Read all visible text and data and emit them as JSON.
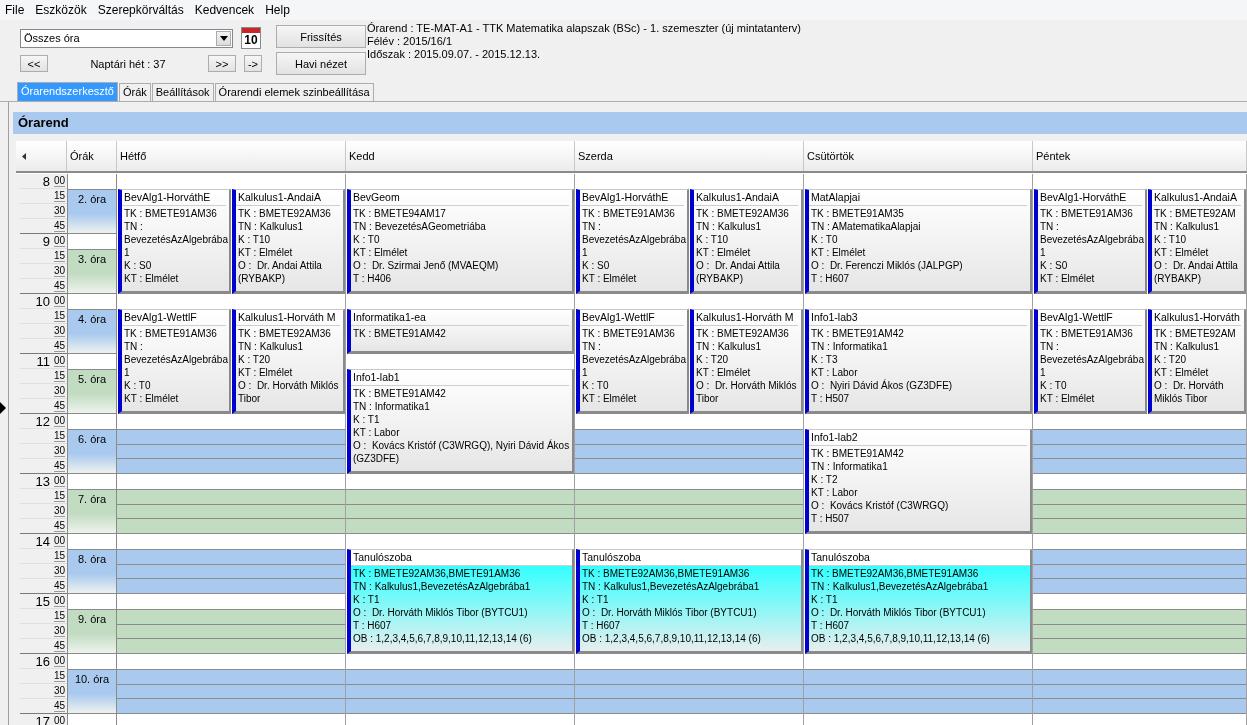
{
  "menu": [
    "File",
    "Eszközök",
    "Szerepkörváltás",
    "Kedvencek",
    "Help"
  ],
  "toolbar": {
    "view_select": {
      "value": "Összes óra"
    },
    "calendar_day": "10",
    "prev_button": "<<",
    "week_label": "Naptári hét : 37",
    "next_button": ">>",
    "jump_button": "->",
    "refresh_button": "Frissítés",
    "month_view_button": "Havi nézet"
  },
  "info": [
    "Órarend : TE-MAT-A1 - TTK Matematika alapszak (BSc) - 1. szemeszter (új mintatanterv)",
    "Félév : 2015/16/1",
    "Időszak : 2015.09.07. - 2015.12.13."
  ],
  "tabs": [
    {
      "label": "Órarendszerkesztő",
      "selected": true
    },
    {
      "label": "Órák",
      "selected": false
    },
    {
      "label": "Beállítások",
      "selected": false
    },
    {
      "label": "Órarendi elemek szinbeállítása",
      "selected": false
    }
  ],
  "panel_title": "Órarend",
  "periods_heading": "Órák",
  "hours": [
    {
      "hour": "8",
      "minutes": [
        "00",
        "15",
        "30",
        "45"
      ]
    },
    {
      "hour": "9",
      "minutes": [
        "00",
        "15",
        "30",
        "45"
      ]
    },
    {
      "hour": "10",
      "minutes": [
        "00",
        "15",
        "30",
        "45"
      ]
    },
    {
      "hour": "11",
      "minutes": [
        "00",
        "15",
        "30",
        "45"
      ]
    },
    {
      "hour": "12",
      "minutes": [
        "00",
        "15",
        "30",
        "45"
      ]
    },
    {
      "hour": "13",
      "minutes": [
        "00",
        "15",
        "30",
        "45"
      ]
    },
    {
      "hour": "14",
      "minutes": [
        "00",
        "15",
        "30",
        "45"
      ]
    },
    {
      "hour": "15",
      "minutes": [
        "00",
        "15",
        "30",
        "45"
      ]
    },
    {
      "hour": "16",
      "minutes": [
        "00",
        "15",
        "30",
        "45"
      ]
    },
    {
      "hour": "17",
      "minutes": [
        "00"
      ]
    }
  ],
  "periods": [
    {
      "label": "2. óra",
      "color": "#a9c9ef"
    },
    {
      "label": "3. óra",
      "color": "#c2dcc2"
    },
    {
      "label": "4. óra",
      "color": "#a9c9ef"
    },
    {
      "label": "5. óra",
      "color": "#c2dcc2"
    },
    {
      "label": "6. óra",
      "color": "#a9c9ef"
    },
    {
      "label": "7. óra",
      "color": "#c2dcc2"
    },
    {
      "label": "8. óra",
      "color": "#a9c9ef"
    },
    {
      "label": "9. óra",
      "color": "#c2dcc2"
    },
    {
      "label": "10. óra",
      "color": "#a9c9ef"
    }
  ],
  "days": [
    {
      "name": "Hétfő",
      "blocks": [
        {
          "kind": "double",
          "events": [
            {
              "title": "BevAlg1-HorváthE",
              "highlighted": false,
              "details": [
                "TK : BMETE91AM36",
                "TN : BevezetésAzAlgebrába1",
                "K : S0",
                "KT : Elmélet"
              ]
            },
            {
              "title": "Kalkulus1-AndaiA",
              "highlighted": false,
              "details": [
                "TK : BMETE92AM36",
                "TN : Kalkulus1",
                "K : T10",
                "KT : Elmélet",
                "O :  Dr. Andai Attila (RYBAKP)"
              ]
            }
          ]
        },
        {
          "kind": "double",
          "events": [
            {
              "title": "BevAlg1-WettlF",
              "highlighted": false,
              "details": [
                "TK : BMETE91AM36",
                "TN : BevezetésAzAlgebrába1",
                "K : T0",
                "KT : Elmélet"
              ]
            },
            {
              "title": "Kalkulus1-Horváth M",
              "highlighted": false,
              "details": [
                "TK : BMETE92AM36",
                "TN : Kalkulus1",
                "K : T20",
                "KT : Elmélet",
                "O :  Dr. Horváth Miklós Tibor"
              ]
            }
          ]
        },
        {
          "kind": "free"
        },
        {
          "kind": "free"
        },
        {
          "kind": "free"
        },
        {
          "kind": "free"
        },
        {
          "kind": "free"
        }
      ]
    },
    {
      "name": "Kedd",
      "blocks": [
        {
          "kind": "double",
          "events": [
            {
              "title": "BevGeom",
              "highlighted": false,
              "details": [
                "TK : BMETE94AM17",
                "TN : BevezetésAGeometriába",
                "K : T0",
                "KT : Elmélet",
                "O :  Dr. Szirmai Jenő (MVAEQM)",
                "T : H406"
              ]
            }
          ]
        },
        {
          "kind": "single",
          "events": [
            {
              "title": "Informatika1-ea",
              "highlighted": false,
              "details": [
                "TK : BMETE91AM42"
              ]
            }
          ]
        },
        {
          "kind": "double",
          "events": [
            {
              "title": "Info1-lab1",
              "highlighted": false,
              "details": [
                "TK : BMETE91AM42",
                "TN : Informatika1",
                "K : T1",
                "KT : Labor",
                "O :  Kovács Kristóf (C3WRGQ), Nyiri Dávid Ákos (GZ3DFE)"
              ]
            }
          ]
        },
        {
          "kind": "free"
        },
        {
          "kind": "double",
          "events": [
            {
              "title": "Tanulószoba",
              "highlighted": true,
              "details": [
                "TK : BMETE92AM36,BMETE91AM36",
                "TN : Kalkulus1,BevezetésAzAlgebrába1",
                "K : T1",
                "O :  Dr. Horváth Miklós Tibor (BYTCU1)",
                "T : H607",
                "OB : 1,2,3,4,5,6,7,8,9,10,11,12,13,14 (6)"
              ]
            }
          ]
        },
        {
          "kind": "free"
        }
      ]
    },
    {
      "name": "Szerda",
      "blocks": [
        {
          "kind": "double",
          "events": [
            {
              "title": "BevAlg1-HorváthE",
              "highlighted": false,
              "details": [
                "TK : BMETE91AM36",
                "TN : BevezetésAzAlgebrába1",
                "K : S0",
                "KT : Elmélet"
              ]
            },
            {
              "title": "Kalkulus1-AndaiA",
              "highlighted": false,
              "details": [
                "TK : BMETE92AM36",
                "TN : Kalkulus1",
                "K : T10",
                "KT : Elmélet",
                "O :  Dr. Andai Attila (RYBAKP)"
              ]
            }
          ]
        },
        {
          "kind": "double",
          "events": [
            {
              "title": "BevAlg1-WettlF",
              "highlighted": false,
              "details": [
                "TK : BMETE91AM36",
                "TN : BevezetésAzAlgebrába1",
                "K : T0",
                "KT : Elmélet"
              ]
            },
            {
              "title": "Kalkulus1-Horváth M",
              "highlighted": false,
              "details": [
                "TK : BMETE92AM36",
                "TN : Kalkulus1",
                "K : T20",
                "KT : Elmélet",
                "O :  Dr. Horváth Miklós Tibor"
              ]
            }
          ]
        },
        {
          "kind": "free"
        },
        {
          "kind": "free"
        },
        {
          "kind": "double",
          "events": [
            {
              "title": "Tanulószoba",
              "highlighted": true,
              "details": [
                "TK : BMETE92AM36,BMETE91AM36",
                "TN : Kalkulus1,BevezetésAzAlgebrába1",
                "K : T1",
                "O :  Dr. Horváth Miklós Tibor (BYTCU1)",
                "T : H607",
                "OB : 1,2,3,4,5,6,7,8,9,10,11,12,13,14 (6)"
              ]
            }
          ]
        },
        {
          "kind": "free"
        }
      ]
    },
    {
      "name": "Csütörtök",
      "blocks": [
        {
          "kind": "double",
          "events": [
            {
              "title": "MatAlapjai",
              "highlighted": false,
              "details": [
                "TK : BMETE91AM35",
                "TN : AMatematikaAlapjai",
                "K : T0",
                "KT : Elmélet",
                "O :  Dr. Ferenczi Miklós (JALPGP)",
                "T : H607"
              ]
            }
          ]
        },
        {
          "kind": "double",
          "events": [
            {
              "title": "Info1-lab3",
              "highlighted": false,
              "details": [
                "TK : BMETE91AM42",
                "TN : Informatika1",
                "K : T3",
                "KT : Labor",
                "O :  Nyiri Dávid Ákos (GZ3DFE)",
                "T : H507"
              ]
            }
          ]
        },
        {
          "kind": "double",
          "events": [
            {
              "title": "Info1-lab2",
              "highlighted": false,
              "details": [
                "TK : BMETE91AM42",
                "TN : Informatika1",
                "K : T2",
                "KT : Labor",
                "O :  Kovács Kristóf (C3WRGQ)",
                "T : H507"
              ]
            }
          ]
        },
        {
          "kind": "double",
          "events": [
            {
              "title": "Tanulószoba",
              "highlighted": true,
              "details": [
                "TK : BMETE92AM36,BMETE91AM36",
                "TN : Kalkulus1,BevezetésAzAlgebrába1",
                "K : T1",
                "O :  Dr. Horváth Miklós Tibor (BYTCU1)",
                "T : H607",
                "OB : 1,2,3,4,5,6,7,8,9,10,11,12,13,14 (6)"
              ]
            }
          ]
        },
        {
          "kind": "free"
        }
      ]
    },
    {
      "name": "Péntek",
      "blocks": [
        {
          "kind": "double",
          "events": [
            {
              "title": "BevAlg1-HorváthE",
              "highlighted": false,
              "details": [
                "TK : BMETE91AM36",
                "TN : BevezetésAzAlgebrába1",
                "K : S0",
                "KT : Elmélet"
              ]
            },
            {
              "title": "Kalkulus1-AndaiA",
              "highlighted": false,
              "details": [
                "TK : BMETE92AM",
                "TN : Kalkulus1",
                "K : T10",
                "KT : Elmélet",
                "O :  Dr. Andai Attila",
                "(RYBAKP)"
              ]
            }
          ]
        },
        {
          "kind": "double",
          "events": [
            {
              "title": "BevAlg1-WettlF",
              "highlighted": false,
              "details": [
                "TK : BMETE91AM36",
                "TN : BevezetésAzAlgebrába1",
                "K : T0",
                "KT : Elmélet"
              ]
            },
            {
              "title": "Kalkulus1-Horváth",
              "highlighted": false,
              "details": [
                "TK : BMETE92AM",
                "TN : Kalkulus1",
                "K : T20",
                "KT : Elmélet",
                "O :  Dr. Horváth",
                "Miklós Tibor"
              ]
            }
          ]
        },
        {
          "kind": "free"
        },
        {
          "kind": "free"
        },
        {
          "kind": "free"
        },
        {
          "kind": "free"
        },
        {
          "kind": "free"
        }
      ]
    }
  ]
}
